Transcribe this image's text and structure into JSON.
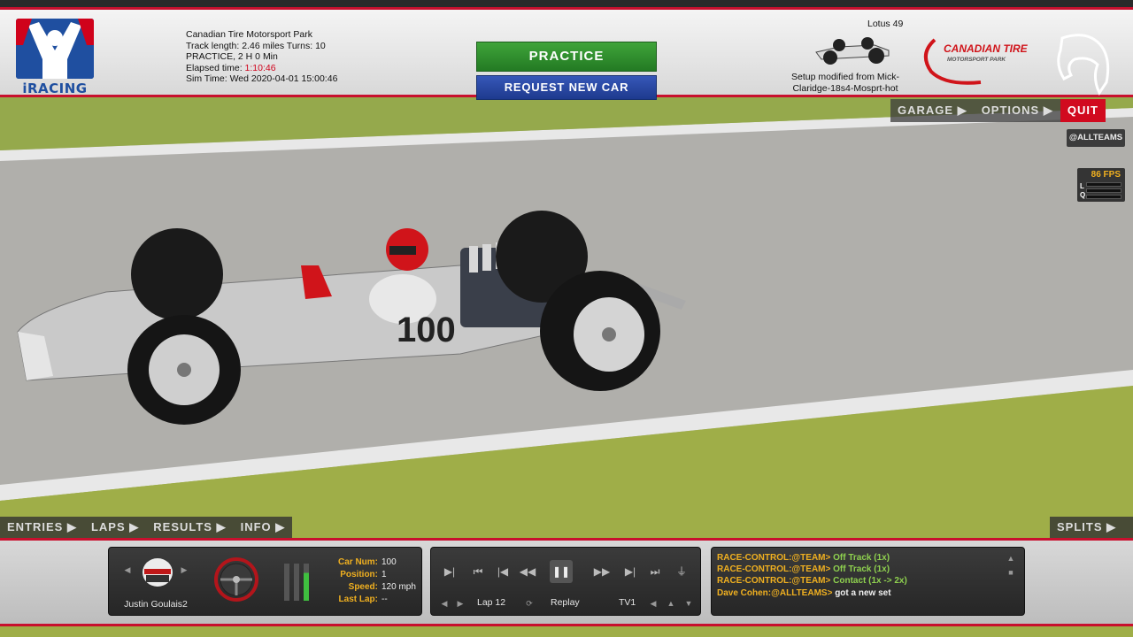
{
  "header": {
    "logo_text": "iRACING",
    "track_name": "Canadian Tire Motorsport Park",
    "track_length": "Track length: 2.46 miles Turns: 10",
    "session": "PRACTICE, 2 H 0 Min",
    "elapsed_label": "Elapsed time:",
    "elapsed_value": "1:10:46",
    "sim_time": "Sim Time: Wed 2020-04-01 15:00:46",
    "practice_button": "PRACTICE",
    "request_button": "REQUEST NEW CAR",
    "car_name": "Lotus 49",
    "setup_text": "Setup modified from Mick-Claridge-18s4-Mosprt-hot",
    "track_logo_line1": "CANADIAN TIRE",
    "track_logo_line2": "MOTORSPORT PARK"
  },
  "right_menu": {
    "garage": "GARAGE",
    "options": "OPTIONS",
    "quit": "QUIT",
    "chat_target": "@ALLTEAMS",
    "fps": "86 FPS",
    "latency_labels": [
      "L",
      "Q"
    ]
  },
  "bottom_menu": {
    "entries": "ENTRIES",
    "laps": "LAPS",
    "results": "RESULTS",
    "info": "INFO",
    "splits": "SPLITS"
  },
  "driver": {
    "name": "Justin Goulais2",
    "stats": [
      {
        "label": "Car Num:",
        "value": "100"
      },
      {
        "label": "Position:",
        "value": "1"
      },
      {
        "label": "Speed:",
        "value": "120 mph"
      },
      {
        "label": "Last Lap:",
        "value": "--"
      }
    ],
    "car_number_on_body": "100"
  },
  "replay": {
    "lap": "Lap 12",
    "mode": "Replay",
    "camera": "TV1"
  },
  "chat": [
    {
      "who": "RACE-CONTROL:@TEAM>",
      "msg": "Off Track (1x)",
      "type": "system"
    },
    {
      "who": "RACE-CONTROL:@TEAM>",
      "msg": "Off Track (1x)",
      "type": "system"
    },
    {
      "who": "RACE-CONTROL:@TEAM>",
      "msg": "Contact (1x -> 2x)",
      "type": "system"
    },
    {
      "who": "Dave Cohen:@ALLTEAMS>",
      "msg": "got a new set",
      "type": "user"
    }
  ],
  "colors": {
    "accent_red": "#c8102e",
    "practice_green": "#2f8f2f",
    "request_blue": "#2a48a6",
    "label_gold": "#f0b020",
    "chat_green": "#8fd14f"
  }
}
